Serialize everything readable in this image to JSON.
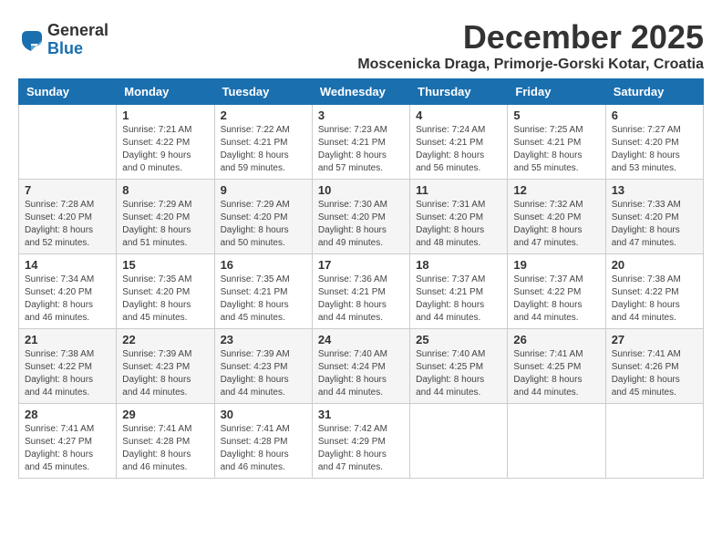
{
  "logo": {
    "general": "General",
    "blue": "Blue"
  },
  "title": "December 2025",
  "location": "Moscenicka Draga, Primorje-Gorski Kotar, Croatia",
  "weekdays": [
    "Sunday",
    "Monday",
    "Tuesday",
    "Wednesday",
    "Thursday",
    "Friday",
    "Saturday"
  ],
  "weeks": [
    [
      {
        "day": "",
        "info": ""
      },
      {
        "day": "1",
        "info": "Sunrise: 7:21 AM\nSunset: 4:22 PM\nDaylight: 9 hours\nand 0 minutes."
      },
      {
        "day": "2",
        "info": "Sunrise: 7:22 AM\nSunset: 4:21 PM\nDaylight: 8 hours\nand 59 minutes."
      },
      {
        "day": "3",
        "info": "Sunrise: 7:23 AM\nSunset: 4:21 PM\nDaylight: 8 hours\nand 57 minutes."
      },
      {
        "day": "4",
        "info": "Sunrise: 7:24 AM\nSunset: 4:21 PM\nDaylight: 8 hours\nand 56 minutes."
      },
      {
        "day": "5",
        "info": "Sunrise: 7:25 AM\nSunset: 4:21 PM\nDaylight: 8 hours\nand 55 minutes."
      },
      {
        "day": "6",
        "info": "Sunrise: 7:27 AM\nSunset: 4:20 PM\nDaylight: 8 hours\nand 53 minutes."
      }
    ],
    [
      {
        "day": "7",
        "info": "Sunrise: 7:28 AM\nSunset: 4:20 PM\nDaylight: 8 hours\nand 52 minutes."
      },
      {
        "day": "8",
        "info": "Sunrise: 7:29 AM\nSunset: 4:20 PM\nDaylight: 8 hours\nand 51 minutes."
      },
      {
        "day": "9",
        "info": "Sunrise: 7:29 AM\nSunset: 4:20 PM\nDaylight: 8 hours\nand 50 minutes."
      },
      {
        "day": "10",
        "info": "Sunrise: 7:30 AM\nSunset: 4:20 PM\nDaylight: 8 hours\nand 49 minutes."
      },
      {
        "day": "11",
        "info": "Sunrise: 7:31 AM\nSunset: 4:20 PM\nDaylight: 8 hours\nand 48 minutes."
      },
      {
        "day": "12",
        "info": "Sunrise: 7:32 AM\nSunset: 4:20 PM\nDaylight: 8 hours\nand 47 minutes."
      },
      {
        "day": "13",
        "info": "Sunrise: 7:33 AM\nSunset: 4:20 PM\nDaylight: 8 hours\nand 47 minutes."
      }
    ],
    [
      {
        "day": "14",
        "info": "Sunrise: 7:34 AM\nSunset: 4:20 PM\nDaylight: 8 hours\nand 46 minutes."
      },
      {
        "day": "15",
        "info": "Sunrise: 7:35 AM\nSunset: 4:20 PM\nDaylight: 8 hours\nand 45 minutes."
      },
      {
        "day": "16",
        "info": "Sunrise: 7:35 AM\nSunset: 4:21 PM\nDaylight: 8 hours\nand 45 minutes."
      },
      {
        "day": "17",
        "info": "Sunrise: 7:36 AM\nSunset: 4:21 PM\nDaylight: 8 hours\nand 44 minutes."
      },
      {
        "day": "18",
        "info": "Sunrise: 7:37 AM\nSunset: 4:21 PM\nDaylight: 8 hours\nand 44 minutes."
      },
      {
        "day": "19",
        "info": "Sunrise: 7:37 AM\nSunset: 4:22 PM\nDaylight: 8 hours\nand 44 minutes."
      },
      {
        "day": "20",
        "info": "Sunrise: 7:38 AM\nSunset: 4:22 PM\nDaylight: 8 hours\nand 44 minutes."
      }
    ],
    [
      {
        "day": "21",
        "info": "Sunrise: 7:38 AM\nSunset: 4:22 PM\nDaylight: 8 hours\nand 44 minutes."
      },
      {
        "day": "22",
        "info": "Sunrise: 7:39 AM\nSunset: 4:23 PM\nDaylight: 8 hours\nand 44 minutes."
      },
      {
        "day": "23",
        "info": "Sunrise: 7:39 AM\nSunset: 4:23 PM\nDaylight: 8 hours\nand 44 minutes."
      },
      {
        "day": "24",
        "info": "Sunrise: 7:40 AM\nSunset: 4:24 PM\nDaylight: 8 hours\nand 44 minutes."
      },
      {
        "day": "25",
        "info": "Sunrise: 7:40 AM\nSunset: 4:25 PM\nDaylight: 8 hours\nand 44 minutes."
      },
      {
        "day": "26",
        "info": "Sunrise: 7:41 AM\nSunset: 4:25 PM\nDaylight: 8 hours\nand 44 minutes."
      },
      {
        "day": "27",
        "info": "Sunrise: 7:41 AM\nSunset: 4:26 PM\nDaylight: 8 hours\nand 45 minutes."
      }
    ],
    [
      {
        "day": "28",
        "info": "Sunrise: 7:41 AM\nSunset: 4:27 PM\nDaylight: 8 hours\nand 45 minutes."
      },
      {
        "day": "29",
        "info": "Sunrise: 7:41 AM\nSunset: 4:28 PM\nDaylight: 8 hours\nand 46 minutes."
      },
      {
        "day": "30",
        "info": "Sunrise: 7:41 AM\nSunset: 4:28 PM\nDaylight: 8 hours\nand 46 minutes."
      },
      {
        "day": "31",
        "info": "Sunrise: 7:42 AM\nSunset: 4:29 PM\nDaylight: 8 hours\nand 47 minutes."
      },
      {
        "day": "",
        "info": ""
      },
      {
        "day": "",
        "info": ""
      },
      {
        "day": "",
        "info": ""
      }
    ]
  ]
}
